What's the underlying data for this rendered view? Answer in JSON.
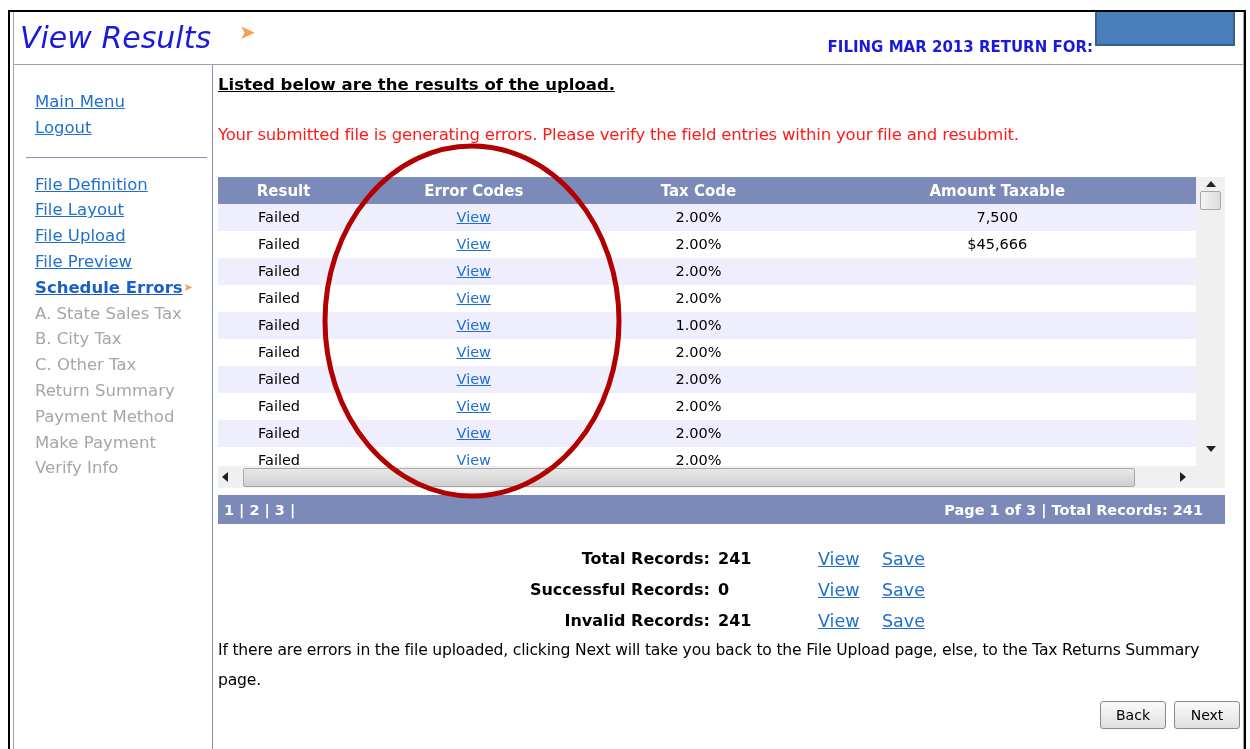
{
  "header": {
    "title": "View Results",
    "arrow": "➤",
    "filing_label": "FILING MAR 2013 RETURN FOR:"
  },
  "sidebar": {
    "top_links": [
      {
        "label": "Main Menu"
      },
      {
        "label": "Logout"
      }
    ],
    "steps": [
      {
        "label": "File Definition",
        "selected": false,
        "disabled": false
      },
      {
        "label": "File Layout",
        "selected": false,
        "disabled": false
      },
      {
        "label": "File Upload",
        "selected": false,
        "disabled": false
      },
      {
        "label": "File Preview",
        "selected": false,
        "disabled": false
      },
      {
        "label": "Schedule Errors",
        "selected": true,
        "disabled": false,
        "marker": "➤"
      },
      {
        "label": "A. State Sales Tax",
        "selected": false,
        "disabled": true
      },
      {
        "label": "B. City Tax",
        "selected": false,
        "disabled": true
      },
      {
        "label": "C. Other Tax",
        "selected": false,
        "disabled": true
      },
      {
        "label": "Return Summary",
        "selected": false,
        "disabled": true
      },
      {
        "label": "Payment Method",
        "selected": false,
        "disabled": true
      },
      {
        "label": "Make Payment",
        "selected": false,
        "disabled": true
      },
      {
        "label": "Verify Info",
        "selected": false,
        "disabled": true
      }
    ]
  },
  "content": {
    "heading": "Listed below are the results of the upload.",
    "error_message": "Your submitted file is generating errors. Please verify the field entries within your file and resubmit."
  },
  "table": {
    "columns": [
      "Result",
      "Error Codes",
      "Tax Code",
      "Amount Taxable"
    ],
    "rows": [
      {
        "result": "Failed",
        "error_codes": "View",
        "tax_code": "2.00%",
        "amount_taxable": "7,500"
      },
      {
        "result": "Failed",
        "error_codes": "View",
        "tax_code": "2.00%",
        "amount_taxable": "$45,666"
      },
      {
        "result": "Failed",
        "error_codes": "View",
        "tax_code": "2.00%"
      },
      {
        "result": "Failed",
        "error_codes": "View",
        "tax_code": "2.00%"
      },
      {
        "result": "Failed",
        "error_codes": "View",
        "tax_code": "1.00%"
      },
      {
        "result": "Failed",
        "error_codes": "View",
        "tax_code": "2.00%"
      },
      {
        "result": "Failed",
        "error_codes": "View",
        "tax_code": "2.00%"
      },
      {
        "result": "Failed",
        "error_codes": "View",
        "tax_code": "2.00%"
      },
      {
        "result": "Failed",
        "error_codes": "View",
        "tax_code": "2.00%"
      },
      {
        "result": "Failed",
        "error_codes": "View",
        "tax_code": "2.00%"
      }
    ]
  },
  "pager": {
    "pages": [
      {
        "label": "1"
      },
      {
        "label": "2"
      },
      {
        "label": "3"
      }
    ],
    "separator": "|",
    "status": "Page 1 of 3 | Total Records: 241"
  },
  "summary": [
    {
      "label": "Total Records:",
      "value": "241",
      "view": "View",
      "save": "Save"
    },
    {
      "label": "Successful Records:",
      "value": "0",
      "view": "View",
      "save": "Save"
    },
    {
      "label": "Invalid Records:",
      "value": "241",
      "view": "View",
      "save": "Save"
    }
  ],
  "note": "If there are errors in the file uploaded, clicking Next will take you back to the File Upload page, else, to the Tax Returns Summary page.",
  "buttons": [
    "Back",
    "Next"
  ]
}
